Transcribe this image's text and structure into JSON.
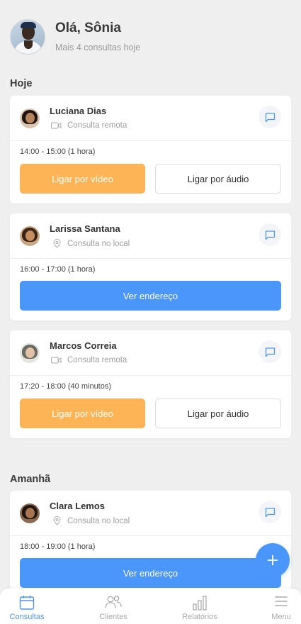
{
  "header": {
    "greeting": "Olá, Sônia",
    "subtitle": "Mais 4 consultas hoje"
  },
  "sections": {
    "today": "Hoje",
    "tomorrow": "Amanhã"
  },
  "appointments": [
    {
      "name": "Luciana Dias",
      "type": "Consulta remota",
      "type_icon": "video-camera-icon",
      "time": "14:00 - 15:00 (1 hora)",
      "video_label": "Ligar por vídeo",
      "audio_label": "Ligar por áudio"
    },
    {
      "name": "Larissa Santana",
      "type": "Consulta no local",
      "type_icon": "location-pin-icon",
      "time": "16:00 - 17:00 (1 hora)",
      "address_label": "Ver endereço"
    },
    {
      "name": "Marcos Correia",
      "type": "Consulta remota",
      "type_icon": "video-camera-icon",
      "time": "17:20 - 18:00 (40 minutos)",
      "video_label": "Ligar por vídeo",
      "audio_label": "Ligar por áudio"
    },
    {
      "name": "Clara Lemos",
      "type": "Consulta no local",
      "type_icon": "location-pin-icon",
      "time": "18:00 - 19:00 (1 hora)",
      "address_label": "Ver endereço"
    }
  ],
  "fab": {
    "icon": "plus-icon"
  },
  "tabbar": [
    {
      "label": "Consultas",
      "icon": "calendar-icon",
      "active": true
    },
    {
      "label": "Clientes",
      "icon": "users-icon",
      "active": false
    },
    {
      "label": "Relatórios",
      "icon": "bar-chart-icon",
      "active": false
    },
    {
      "label": "Menu",
      "icon": "hamburger-menu-icon",
      "active": false
    }
  ],
  "colors": {
    "accent_blue": "#4b96fb",
    "accent_orange": "#fdb456",
    "background": "#efefef"
  }
}
